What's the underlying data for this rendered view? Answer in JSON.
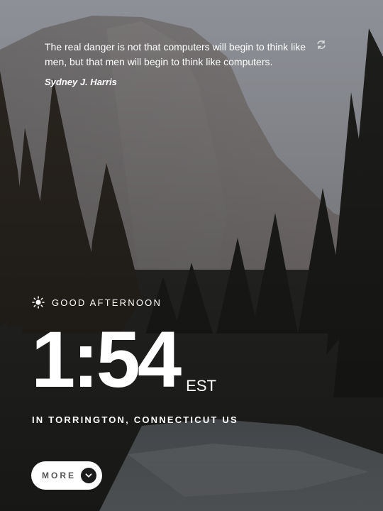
{
  "quote": {
    "text": "The real danger is not that computers will begin to think like men, but that men will begin to think like computers.",
    "author": "Sydney J. Harris"
  },
  "greeting": {
    "text": "GOOD AFTERNOON",
    "icon": "sun-icon"
  },
  "clock": {
    "time": "1:54",
    "timezone": "EST"
  },
  "location": {
    "text": "IN TORRINGTON, CONNECTICUT US"
  },
  "more_button": {
    "label": "MORE",
    "icon": "chevron-down-icon"
  },
  "refresh_icon": "refresh-icon"
}
